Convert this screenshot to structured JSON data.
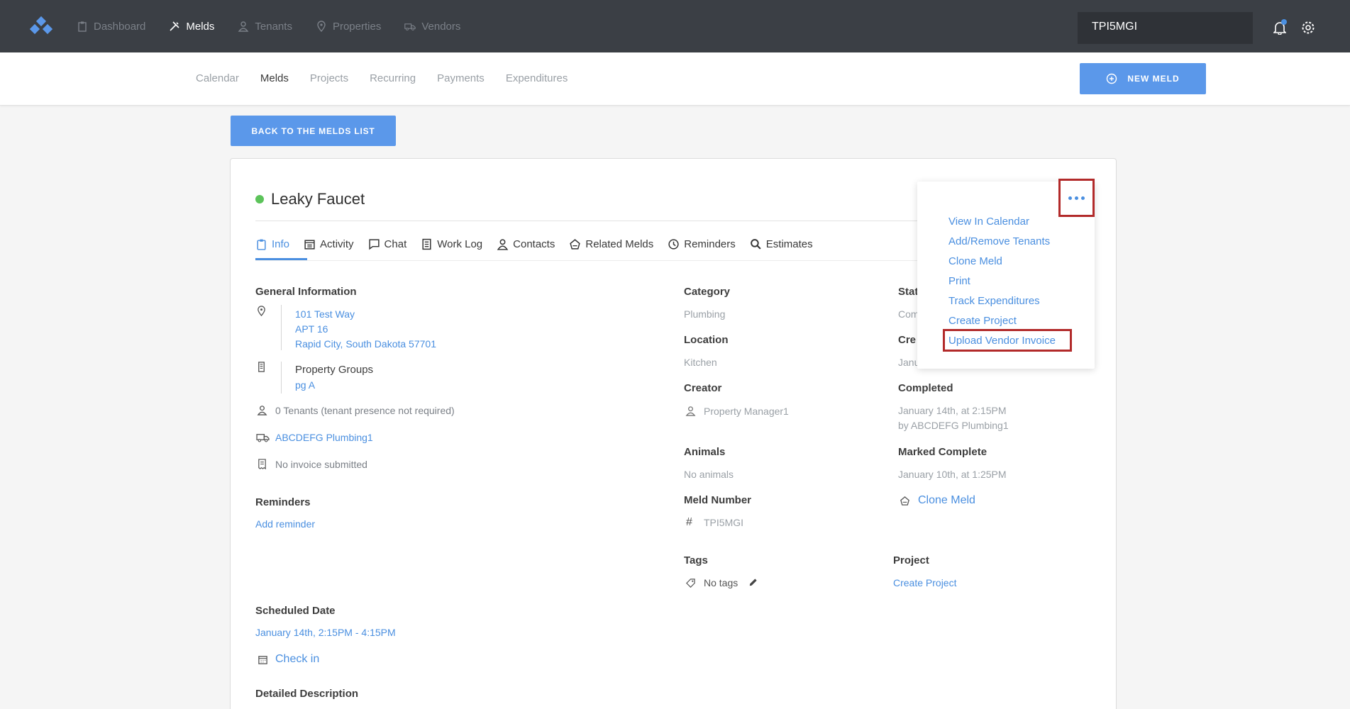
{
  "topnav": {
    "items": [
      {
        "label": "Dashboard",
        "icon": "clipboard-icon",
        "active": false
      },
      {
        "label": "Melds",
        "icon": "tools-icon",
        "active": true
      },
      {
        "label": "Tenants",
        "icon": "person-icon",
        "active": false
      },
      {
        "label": "Properties",
        "icon": "map-pin-icon",
        "active": false
      },
      {
        "label": "Vendors",
        "icon": "truck-icon",
        "active": false
      }
    ],
    "search_value": "TPI5MGI"
  },
  "subnav": {
    "items": [
      "Calendar",
      "Melds",
      "Projects",
      "Recurring",
      "Payments",
      "Expenditures"
    ],
    "active": "Melds",
    "new_meld_label": "NEW MELD"
  },
  "back_button_label": "BACK TO THE MELDS LIST",
  "meld": {
    "title": "Leaky Faucet",
    "status_color": "#5cc35a",
    "tabs": [
      "Info",
      "Activity",
      "Chat",
      "Work Log",
      "Contacts",
      "Related Melds",
      "Reminders",
      "Estimates"
    ],
    "general": {
      "heading": "General Information",
      "address_line1": "101 Test Way",
      "address_line2": "APT 16",
      "address_line3": "Rapid City, South Dakota 57701",
      "property_groups_label": "Property Groups",
      "property_group": "pg A",
      "tenants": "0 Tenants (tenant presence not required)",
      "vendor": "ABCDEFG Plumbing1",
      "invoice": "No invoice submitted"
    },
    "reminders": {
      "heading": "Reminders",
      "add": "Add reminder"
    },
    "scheduled": {
      "heading": "Scheduled Date",
      "value": "January 14th, 2:15PM - 4:15PM",
      "checkin": "Check in"
    },
    "detailed_description_heading": "Detailed Description",
    "category": {
      "heading": "Category",
      "value": "Plumbing"
    },
    "location": {
      "heading": "Location",
      "value": "Kitchen"
    },
    "creator": {
      "heading": "Creator",
      "value": "Property Manager1"
    },
    "animals": {
      "heading": "Animals",
      "value": "No animals"
    },
    "meld_number": {
      "heading": "Meld Number",
      "value": "TPI5MGI"
    },
    "tags": {
      "heading": "Tags",
      "value": "No tags"
    },
    "status_partial": {
      "heading": "Stat",
      "value": "Com"
    },
    "created_partial": {
      "heading": "Cre",
      "value": "Janu"
    },
    "completed": {
      "heading": "Completed",
      "line1": "January 14th, at 2:15PM",
      "line2": "by ABCDEFG Plumbing1"
    },
    "marked_complete": {
      "heading": "Marked Complete",
      "value": "January 10th, at 1:25PM"
    },
    "clone_meld": "Clone Meld",
    "project": {
      "heading": "Project",
      "value": "Create Project"
    }
  },
  "menu": {
    "items": [
      "View In Calendar",
      "Add/Remove Tenants",
      "Clone Meld",
      "Print",
      "Track Expenditures",
      "Create Project",
      "Upload Vendor Invoice"
    ]
  },
  "colors": {
    "accent": "#4a8fe0",
    "button": "#5b98ea",
    "topbar": "#3b3f45",
    "highlight": "#b22a2a"
  }
}
